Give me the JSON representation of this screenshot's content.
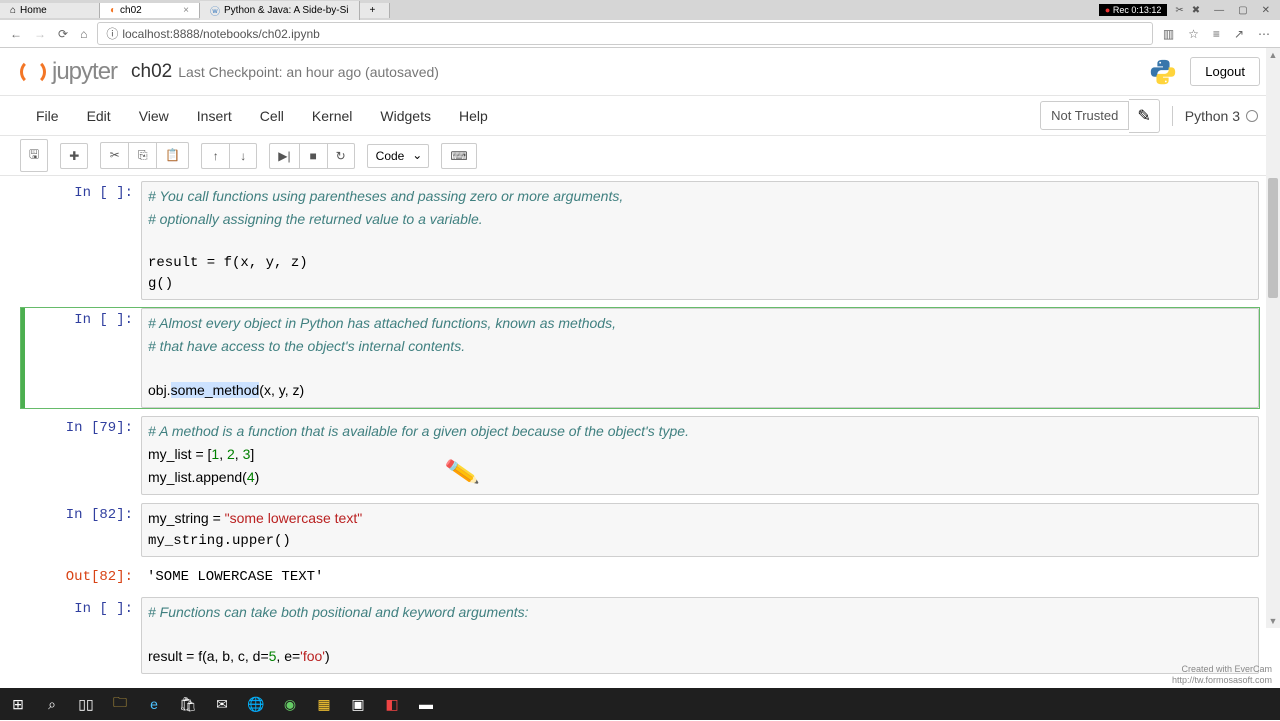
{
  "browser": {
    "tabs": [
      {
        "label": "Home",
        "active": false
      },
      {
        "label": "ch02",
        "active": true
      },
      {
        "label": "Python & Java: A Side-by-Si",
        "active": false
      }
    ],
    "url": "localhost:8888/notebooks/ch02.ipynb",
    "rec_label": "Rec 0:13:12"
  },
  "header": {
    "logo_text": "jupyter",
    "nb_title": "ch02",
    "checkpoint": "Last Checkpoint: an hour ago (autosaved)",
    "logout": "Logout"
  },
  "menubar": {
    "items": [
      "File",
      "Edit",
      "View",
      "Insert",
      "Cell",
      "Kernel",
      "Widgets",
      "Help"
    ],
    "trust": "Not Trusted",
    "kernel": "Python 3"
  },
  "toolbar": {
    "cell_type": "Code"
  },
  "cells": [
    {
      "prompt": "In [ ]:",
      "lines": [
        {
          "c": "# You call functions using parentheses and passing zero or more arguments,"
        },
        {
          "c": "# optionally assigning the returned value to a variable."
        },
        {
          "t": ""
        },
        {
          "t": "result = f(x, y, z)"
        },
        {
          "t": "g()"
        }
      ],
      "selected": false
    },
    {
      "prompt": "In [ ]:",
      "lines": [
        {
          "c": "# Almost every object in Python has attached functions, known as methods,"
        },
        {
          "c": "# that have access to the object's internal contents."
        },
        {
          "t": ""
        },
        {
          "mixed": [
            {
              "t": "obj."
            },
            {
              "sel": "some_method"
            },
            {
              "t": "(x, y, z)"
            }
          ]
        }
      ],
      "selected": true
    },
    {
      "prompt": "In [79]:",
      "lines": [
        {
          "c": "# A method is a function that is available for a given object because of the object's type."
        },
        {
          "mixed": [
            {
              "t": "my_list = ["
            },
            {
              "n": "1"
            },
            {
              "t": ", "
            },
            {
              "n": "2"
            },
            {
              "t": ", "
            },
            {
              "n": "3"
            },
            {
              "t": "]"
            }
          ]
        },
        {
          "mixed": [
            {
              "t": "my_list.append("
            },
            {
              "n": "4"
            },
            {
              "t": ")"
            }
          ]
        }
      ],
      "selected": false
    },
    {
      "prompt": "In [82]:",
      "lines": [
        {
          "mixed": [
            {
              "t": "my_string = "
            },
            {
              "s": "\"some lowercase text\""
            }
          ]
        },
        {
          "t": "my_string.upper()"
        }
      ],
      "selected": false
    },
    {
      "out_prompt": "Out[82]:",
      "output": "'SOME LOWERCASE TEXT'"
    },
    {
      "prompt": "In [ ]:",
      "lines": [
        {
          "c": "# Functions can take both positional and keyword arguments:"
        },
        {
          "t": ""
        },
        {
          "mixed": [
            {
              "t": "result = f(a, b, c, d="
            },
            {
              "n": "5"
            },
            {
              "t": ", e="
            },
            {
              "s": "'foo'"
            },
            {
              "t": ")"
            }
          ]
        }
      ],
      "selected": false
    }
  ],
  "watermark": {
    "line1": "Created with EverCam",
    "line2": "http://tw.formosasoft.com"
  }
}
